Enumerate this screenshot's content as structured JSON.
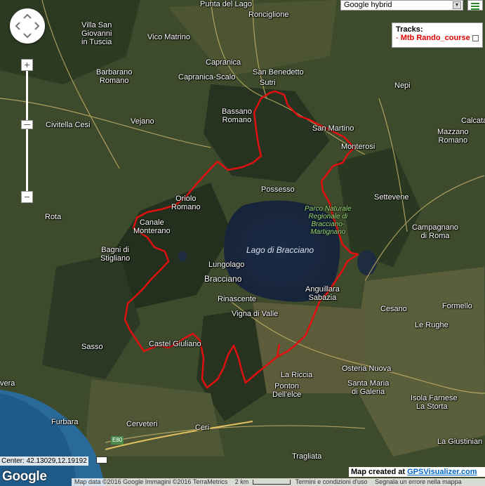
{
  "map_type": {
    "selected": "Google hybrid"
  },
  "tracks": {
    "title": "Tracks:",
    "prefix": "- ",
    "name": "Mtb Rando_course"
  },
  "places": {
    "punta_del_lago": "Punta del Lago",
    "ronciglione": "Ronciglione",
    "villa_san_giovanni": "Villa San\nGiovanni\nin Tuscia",
    "vico_matrino": "Vico Matrino",
    "capranica": "Capranica",
    "capranica_scalo": "Capranica-Scalo",
    "san_benedetto": "San Benedetto",
    "sutri": "Sutri",
    "barbarano": "Barbarano\nRomano",
    "nepi": "Nepi",
    "civitella_cesi": "Civitella Cesi",
    "vejano": "Vejano",
    "bassano": "Bassano\nRomano",
    "san_martino": "San Martino",
    "mazzano": "Mazzano\nRomano",
    "calcata": "Calcata",
    "monterosi": "Monterosi",
    "possesso": "Possesso",
    "settevene": "Settevene",
    "oriolo": "Oriolo\nRomano",
    "rota": "Rota",
    "canale": "Canale\nMonterano",
    "park": "Parco Naturale\nRegionale di\nBracciano-\nMartignano",
    "campagnano": "Campagnano\ndi Roma",
    "bagni": "Bagni di\nStigliano",
    "lake": "Lago di Bracciano",
    "lungolago": "Lungolago",
    "bracciano": "Bracciano",
    "anguillara": "Anguillara\nSabazia",
    "rinascente": "Rinascente",
    "vigna_di_valle": "Vigna di Valle",
    "cesano": "Cesano",
    "formello": "Formello",
    "le_rughe": "Le Rughe",
    "sasso": "Sasso",
    "castel_giuliano": "Castel Giuliano",
    "la_riccia": "La Riccia",
    "osteria_nuova": "Osteria Nuova",
    "ponton": "Ponton\nDell'elce",
    "santa_maria": "Santa Maria\ndi Galeria",
    "isola_farnese": "Isola Farnese",
    "la_storta": "La Storta",
    "vera": "vera",
    "furbara": "Furbara",
    "cerveteri": "Cerveteri",
    "ceri": "Ceri",
    "tragliata": "Tragliata",
    "la_giustiniana": "La Giustinian",
    "e80": "E80"
  },
  "center": "Center: 42.13029,12.19192",
  "logo": "Google",
  "credit": {
    "prefix": "Map created at ",
    "link": "GPSVisualizer.com"
  },
  "footer": {
    "data": "Map data ©2016 Google Immagini ©2016 TerraMetrics",
    "scale": "2 km",
    "terms": "Termini e condizioni d'uso",
    "report": "Segnala un errore nella mappa"
  },
  "colors": {
    "track": "#e01010",
    "lake": "#1a2a44"
  }
}
